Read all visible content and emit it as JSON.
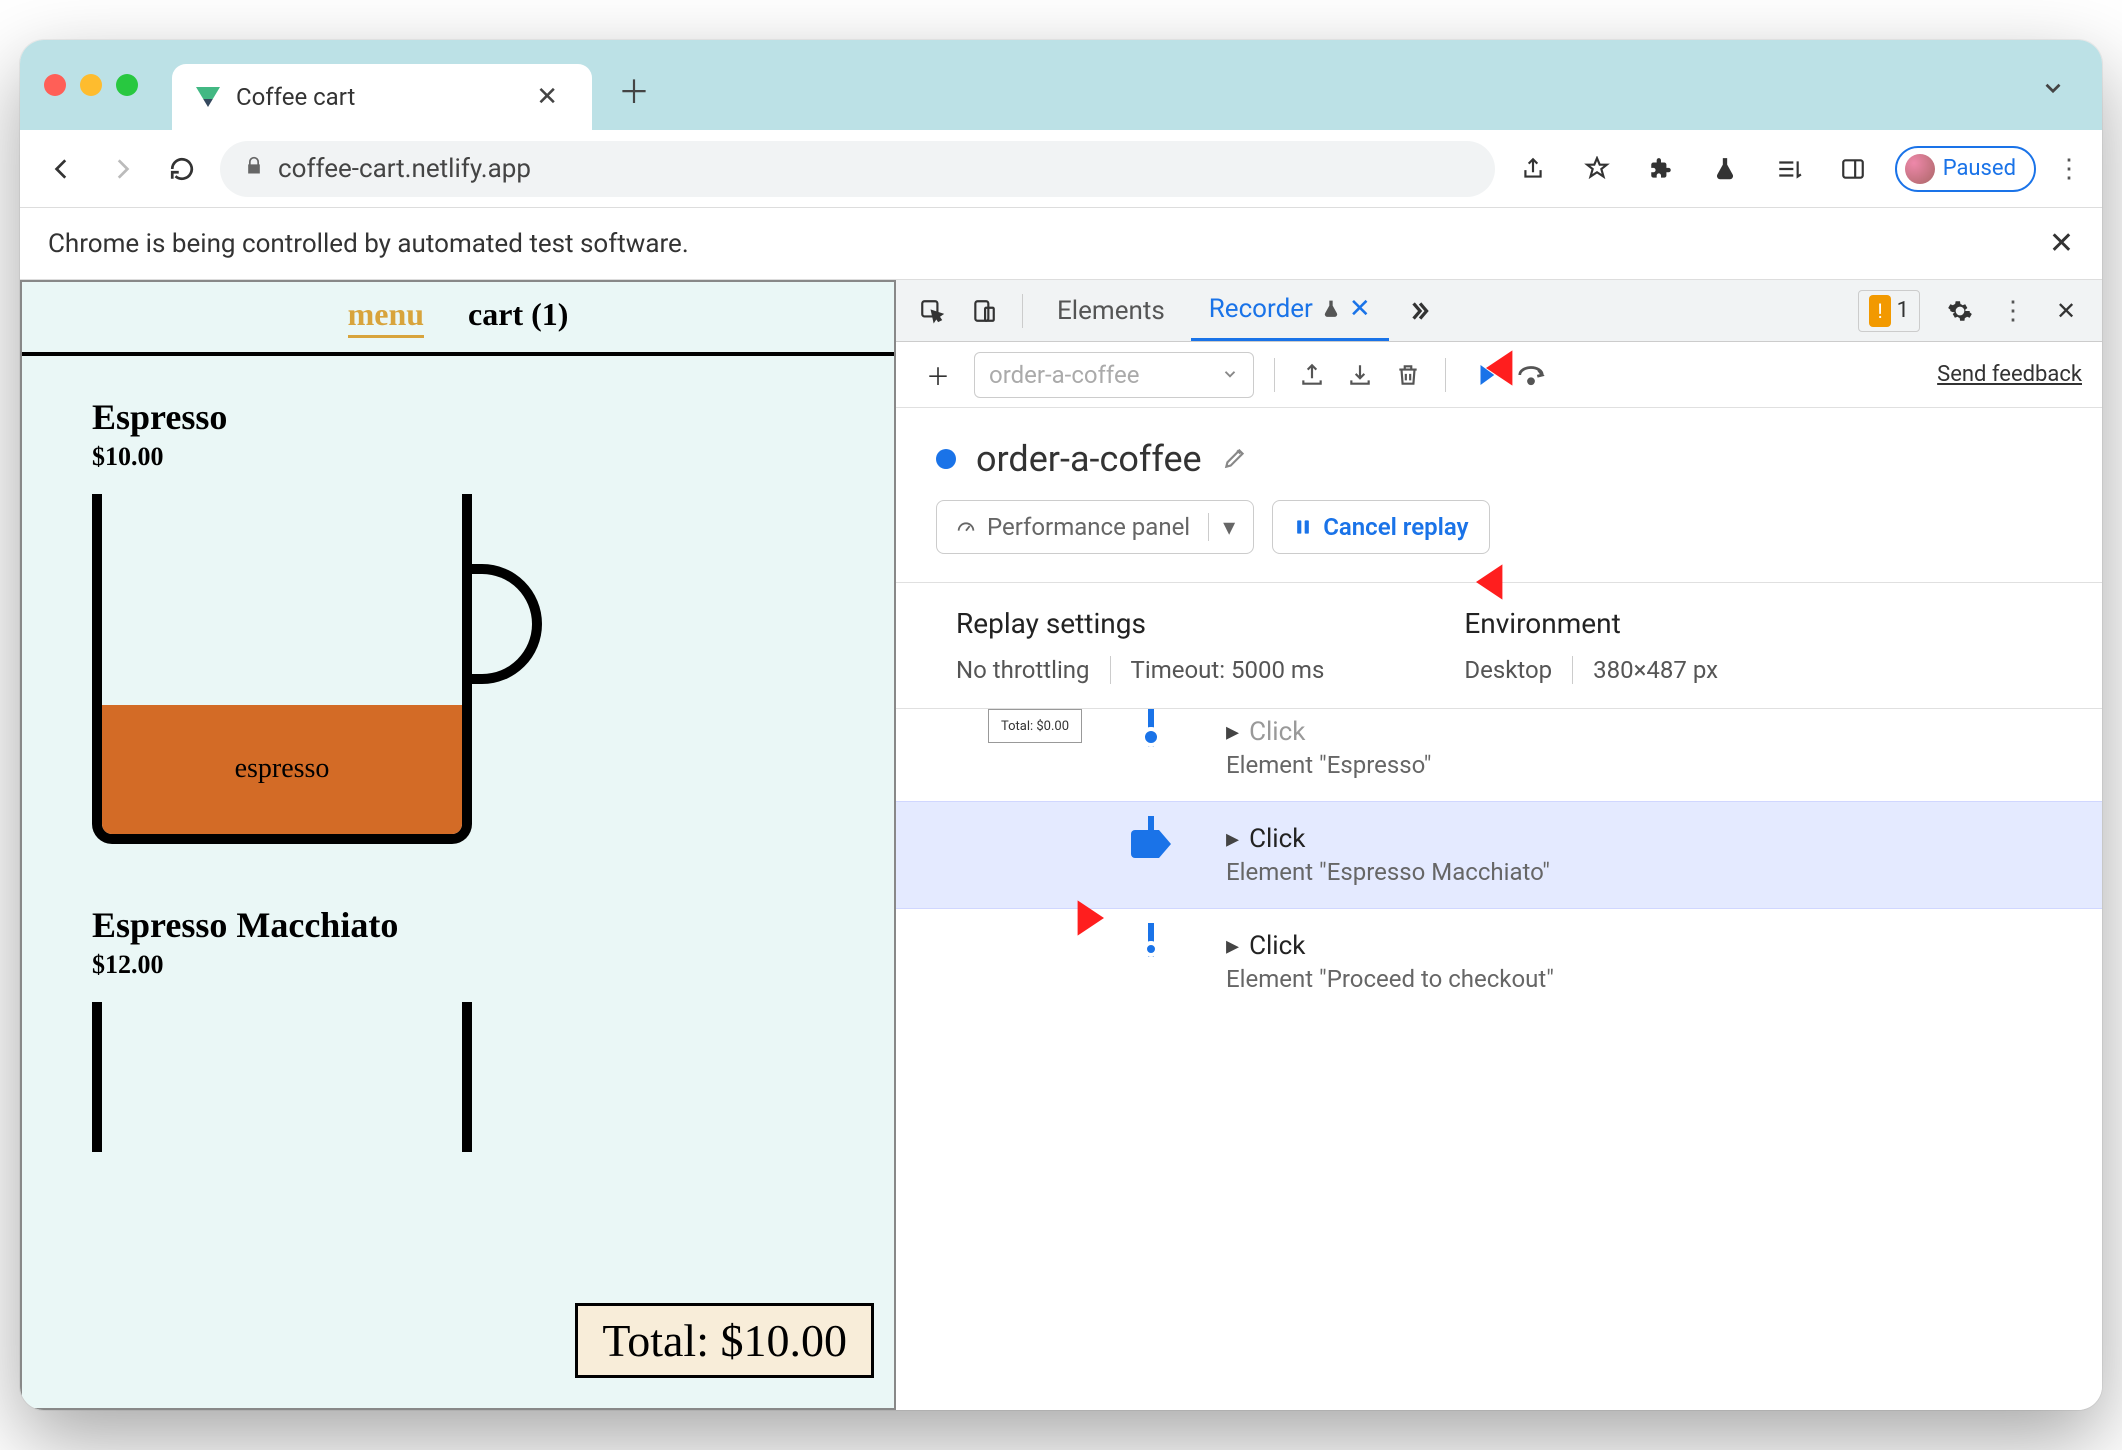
{
  "browser": {
    "tab_title": "Coffee cart",
    "url": "coffee-cart.netlify.app",
    "paused_label": "Paused",
    "info_bar": "Chrome is being controlled by automated test software."
  },
  "page": {
    "nav": {
      "menu": "menu",
      "cart": "cart (1)"
    },
    "products": [
      {
        "name": "Espresso",
        "price": "$10.00",
        "fill_label": "espresso"
      },
      {
        "name": "Espresso Macchiato",
        "price": "$12.00"
      }
    ],
    "total_label": "Total: $10.00"
  },
  "devtools": {
    "tabs": {
      "elements": "Elements",
      "recorder": "Recorder"
    },
    "issues_count": "1",
    "send_feedback": "Send feedback",
    "recording_dropdown": "order-a-coffee",
    "recording_name": "order-a-coffee",
    "perf_panel_label": "Performance panel",
    "cancel_label": "Cancel replay",
    "settings": {
      "replay_title": "Replay settings",
      "throttling": "No throttling",
      "timeout": "Timeout: 5000 ms",
      "env_title": "Environment",
      "device": "Desktop",
      "viewport": "380×487 px"
    },
    "steps": [
      {
        "action": "Click",
        "element": "Element \"Espresso\"",
        "thumb": "Total: $0.00"
      },
      {
        "action": "Click",
        "element": "Element \"Espresso Macchiato\""
      },
      {
        "action": "Click",
        "element": "Element \"Proceed to checkout\""
      }
    ]
  }
}
